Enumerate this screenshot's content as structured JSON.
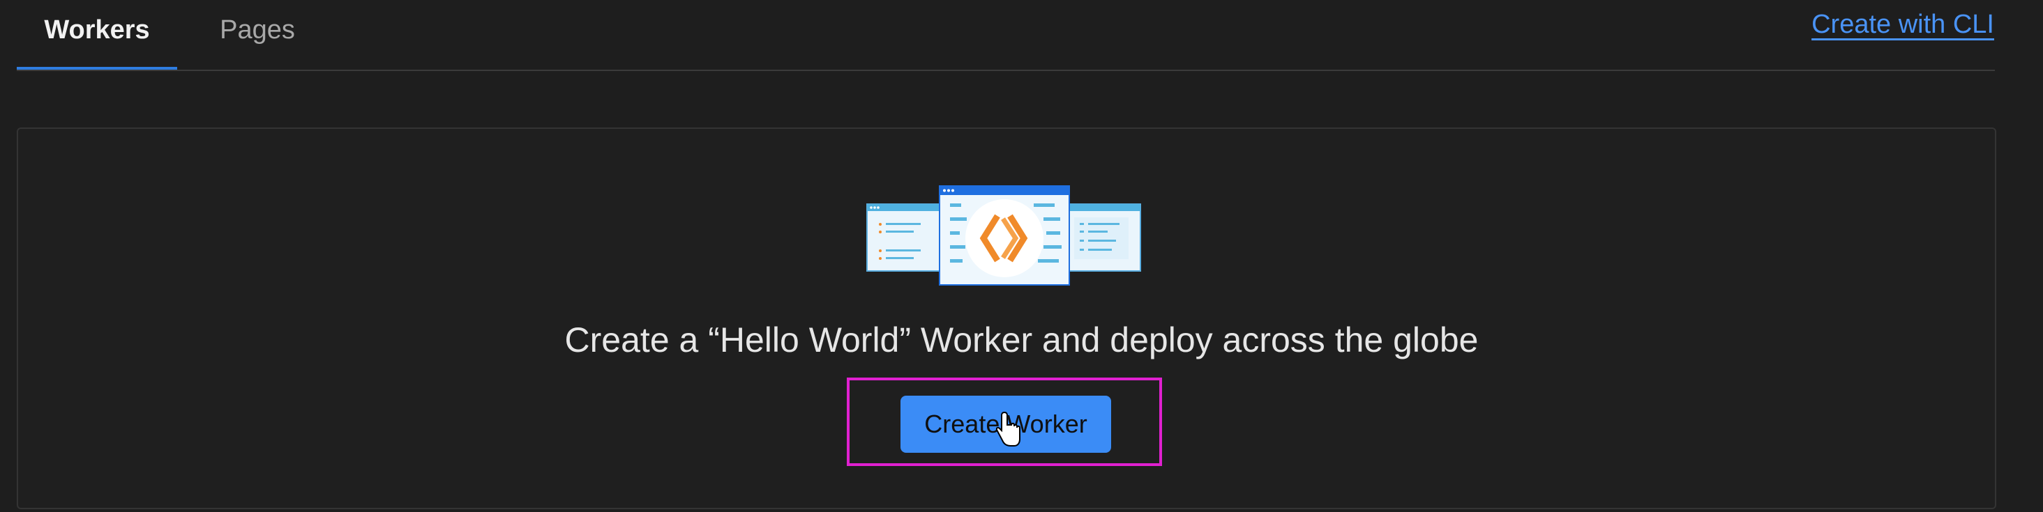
{
  "tabs": [
    {
      "label": "Workers",
      "active": true
    },
    {
      "label": "Pages",
      "active": false
    }
  ],
  "header": {
    "cli_link": "Create with CLI"
  },
  "empty_state": {
    "headline": "Create a “Hello World” Worker and deploy across the globe",
    "button_label": "Create Worker",
    "illustration_icon": "cloudflare-workers-logo-icon"
  },
  "colors": {
    "accent": "#3b8cf6",
    "link": "#4a93f5",
    "highlight_border": "#e020d0",
    "background": "#1e1e1e"
  }
}
